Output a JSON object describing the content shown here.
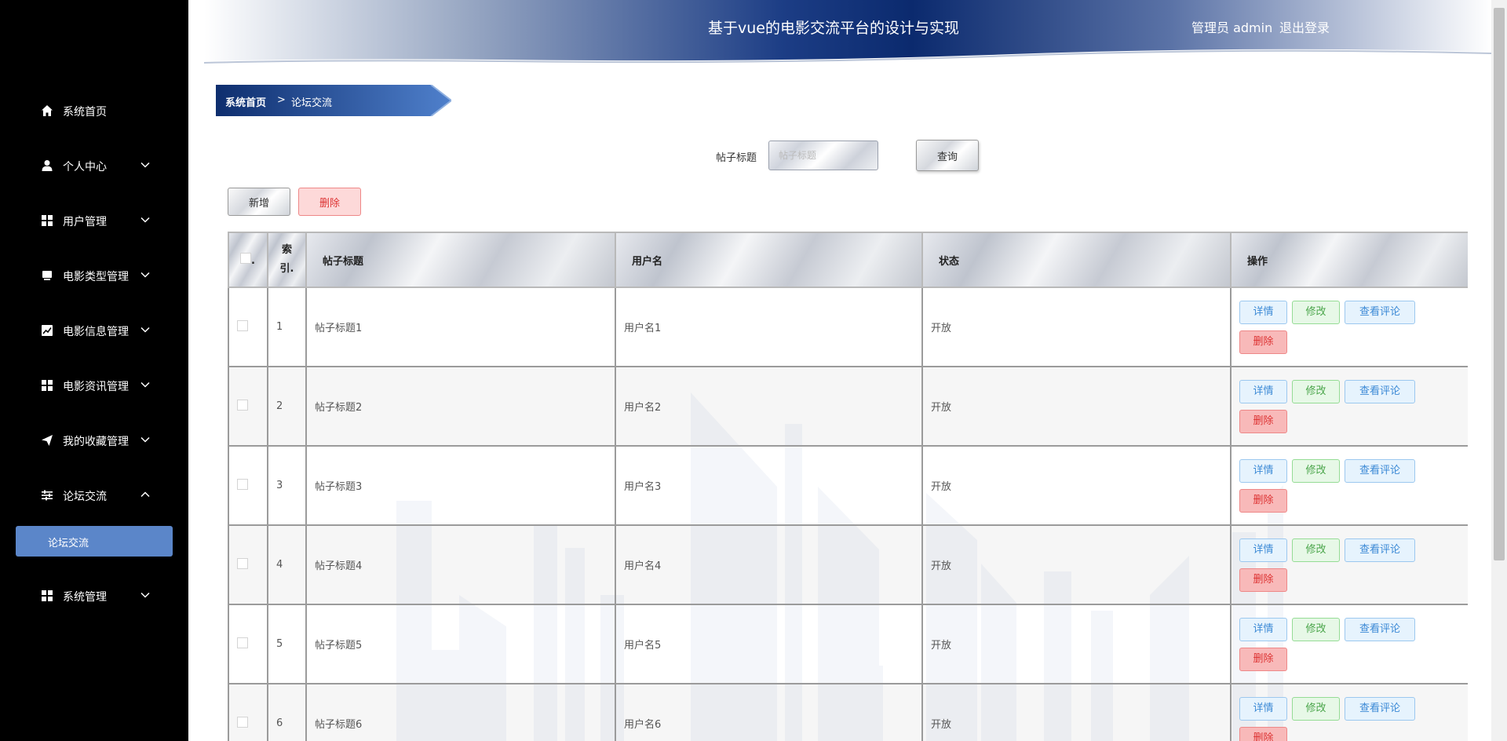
{
  "app": {
    "title": "基于vue的电影交流平台的设计与实现",
    "user_label": "管理员 admin",
    "logout_label": "退出登录"
  },
  "sidebar": {
    "items": [
      {
        "label": "系统首页",
        "icon": "home-icon"
      },
      {
        "label": "个人中心",
        "icon": "user-icon",
        "chevron": "chevron-down-icon"
      },
      {
        "label": "用户管理",
        "icon": "grid-icon",
        "chevron": "chevron-down-icon"
      },
      {
        "label": "电影类型管理",
        "icon": "tablet-icon",
        "chevron": "chevron-down-icon"
      },
      {
        "label": "电影信息管理",
        "icon": "chart-icon",
        "chevron": "chevron-down-icon"
      },
      {
        "label": "电影资讯管理",
        "icon": "grid-icon",
        "chevron": "chevron-down-icon"
      },
      {
        "label": "我的收藏管理",
        "icon": "send-icon",
        "chevron": "chevron-down-icon"
      },
      {
        "label": "论坛交流",
        "icon": "sliders-icon",
        "chevron": "chevron-up-icon"
      },
      {
        "label": "系统管理",
        "icon": "grid-icon",
        "chevron": "chevron-down-icon"
      }
    ],
    "active_sub": "论坛交流"
  },
  "breadcrumb": {
    "home": "系统首页",
    "separator": ">",
    "current": "论坛交流"
  },
  "search": {
    "label": "帖子标题",
    "placeholder": "帖子标题",
    "button": "查询"
  },
  "toolbar": {
    "add_label": "新增",
    "delete_label": "删除"
  },
  "table": {
    "headers": {
      "select": ".",
      "index": "索引.",
      "title": "帖子标题",
      "username": "用户名",
      "status": "状态",
      "actions": "操作"
    },
    "rows": [
      {
        "index": "1",
        "title": "帖子标题1",
        "username": "用户名1",
        "status": "开放"
      },
      {
        "index": "2",
        "title": "帖子标题2",
        "username": "用户名2",
        "status": "开放"
      },
      {
        "index": "3",
        "title": "帖子标题3",
        "username": "用户名3",
        "status": "开放"
      },
      {
        "index": "4",
        "title": "帖子标题4",
        "username": "用户名4",
        "status": "开放"
      },
      {
        "index": "5",
        "title": "帖子标题5",
        "username": "用户名5",
        "status": "开放"
      },
      {
        "index": "6",
        "title": "帖子标题6",
        "username": "用户名6",
        "status": "开放"
      }
    ],
    "row_actions": {
      "detail": "详情",
      "edit": "修改",
      "comments": "查看评论",
      "delete": "删除"
    }
  },
  "colors": {
    "sidebar_bg": "#000000",
    "header_dark": "#0b2a6e",
    "active_sub_bg": "#5b86c9",
    "breadcrumb_start": "#0e2e6e",
    "breadcrumb_end": "#4f80cc"
  }
}
